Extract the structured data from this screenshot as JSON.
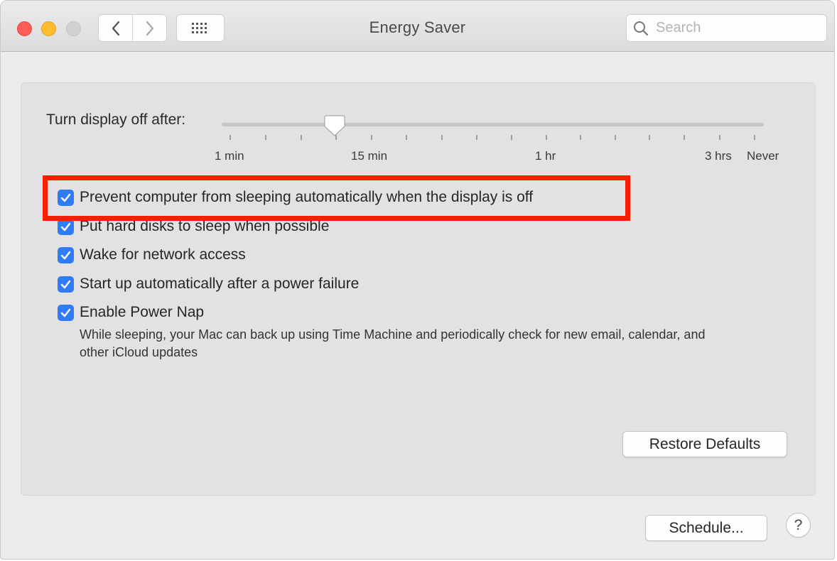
{
  "window": {
    "title": "Energy Saver"
  },
  "toolbar": {
    "back_icon": "chevron-left-icon",
    "forward_icon": "chevron-right-icon",
    "grid_icon": "grid-icon"
  },
  "search": {
    "placeholder": "Search",
    "value": ""
  },
  "display_slider": {
    "label": "Turn display off after:",
    "tick_labels": [
      "1 min",
      "15 min",
      "1 hr",
      "3 hrs",
      "Never"
    ],
    "selected_value": "15 min"
  },
  "options": [
    {
      "label": "Prevent computer from sleeping automatically when the display is off",
      "checked": true
    },
    {
      "label": "Put hard disks to sleep when possible",
      "checked": true
    },
    {
      "label": "Wake for network access",
      "checked": true
    },
    {
      "label": "Start up automatically after a power failure",
      "checked": true
    },
    {
      "label": "Enable Power Nap",
      "checked": true
    }
  ],
  "power_nap_description": "While sleeping, your Mac can back up using Time Machine and periodically check for new email, calendar, and other iCloud updates",
  "buttons": {
    "restore_defaults": "Restore Defaults",
    "schedule": "Schedule...",
    "help": "?"
  },
  "colors": {
    "accent": "#2f7cf6",
    "highlight": "#fb1d00",
    "close": "#fd5f57",
    "minimize": "#febc2e",
    "zoom_disabled": "#d2d2d2"
  }
}
